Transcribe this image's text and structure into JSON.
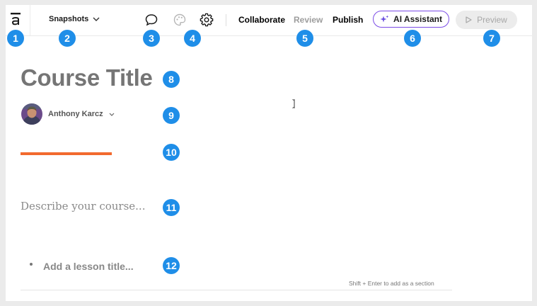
{
  "toolbar": {
    "logo_icon": "articulate-a-logo-icon",
    "snapshots_label": "Snapshots",
    "comment_icon": "comment-bubble-icon",
    "theme_icon": "palette-icon",
    "settings_icon": "gear-icon",
    "nav": [
      {
        "label": "Collaborate",
        "color": "#1a1a1a"
      },
      {
        "label": "Review",
        "color": "#9d9d9d"
      },
      {
        "label": "Publish",
        "color": "#1a1a1a"
      }
    ],
    "ai_button_label": "AI Assistant",
    "ai_icon": "sparkle-icon",
    "ai_accent": "#7b4ce6",
    "preview_label": "Preview",
    "preview_icon": "play-icon"
  },
  "editor": {
    "course_title": "Course Title",
    "author_name": "Anthony Karcz",
    "description_placeholder": "Describe your course...",
    "lesson_placeholder": "Add a lesson title...",
    "section_hint": "Shift + Enter to add as a section",
    "accent_color": "#f26a2e"
  },
  "annotations": [
    "1",
    "2",
    "3",
    "4",
    "5",
    "6",
    "7",
    "8",
    "9",
    "10",
    "11",
    "12"
  ],
  "badge_color": "#1f8ee8"
}
